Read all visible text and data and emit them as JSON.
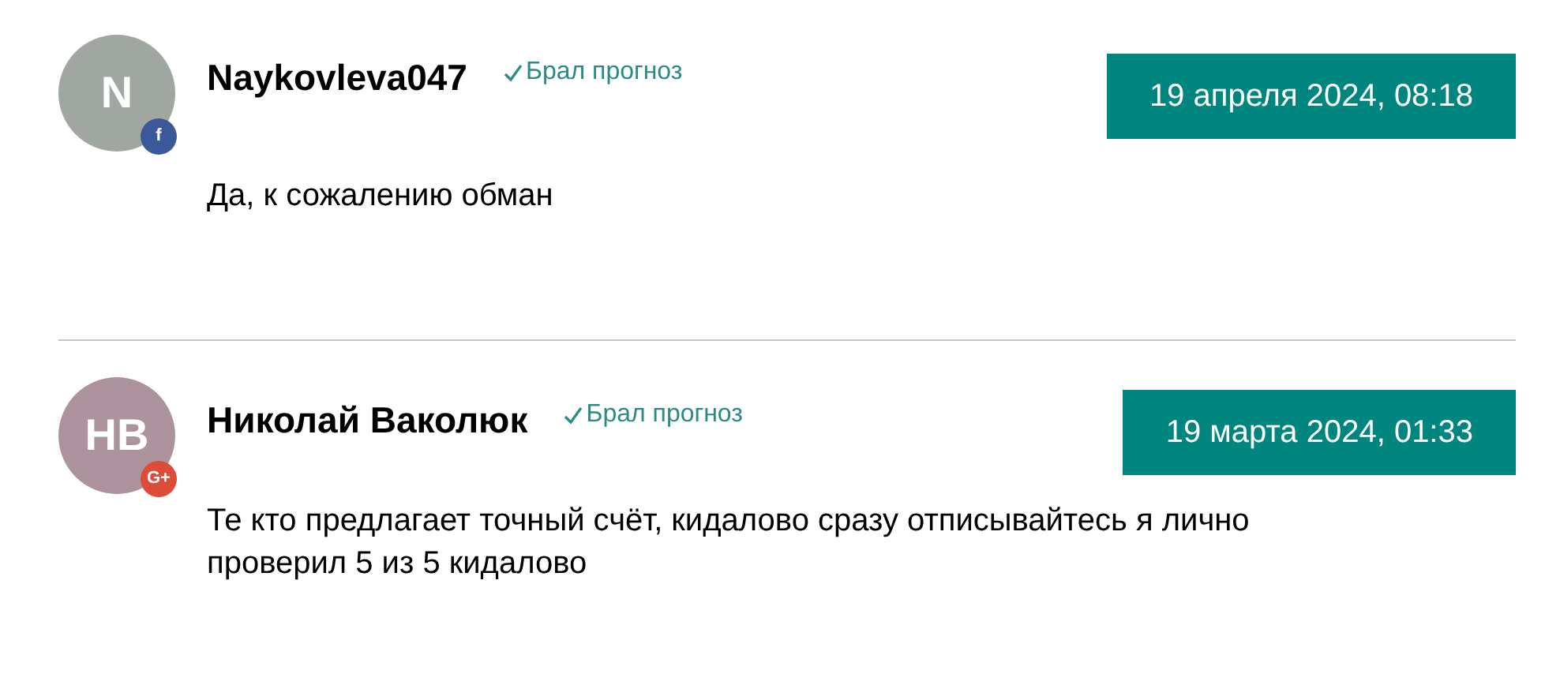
{
  "comments": [
    {
      "avatar": {
        "initials": "N",
        "color": "#a0a7a0"
      },
      "badge": {
        "kind": "facebook",
        "label": "f"
      },
      "author": "Naykovleva047",
      "verified": true,
      "verified_label": "Брал прогноз",
      "date": "19 апреля 2024, 08:18",
      "text": "Да, к сожалению обман"
    },
    {
      "avatar": {
        "initials": "НВ",
        "color": "#ad939e"
      },
      "badge": {
        "kind": "google",
        "label": "G+"
      },
      "author": "Николай Ваколюк",
      "verified": true,
      "verified_label": "Брал прогноз",
      "date": "19 марта 2024, 01:33",
      "text": "Те кто предлагает точный счёт, кидалово сразу отписывайтесь я лично проверил 5 из 5 кидалово"
    }
  ]
}
